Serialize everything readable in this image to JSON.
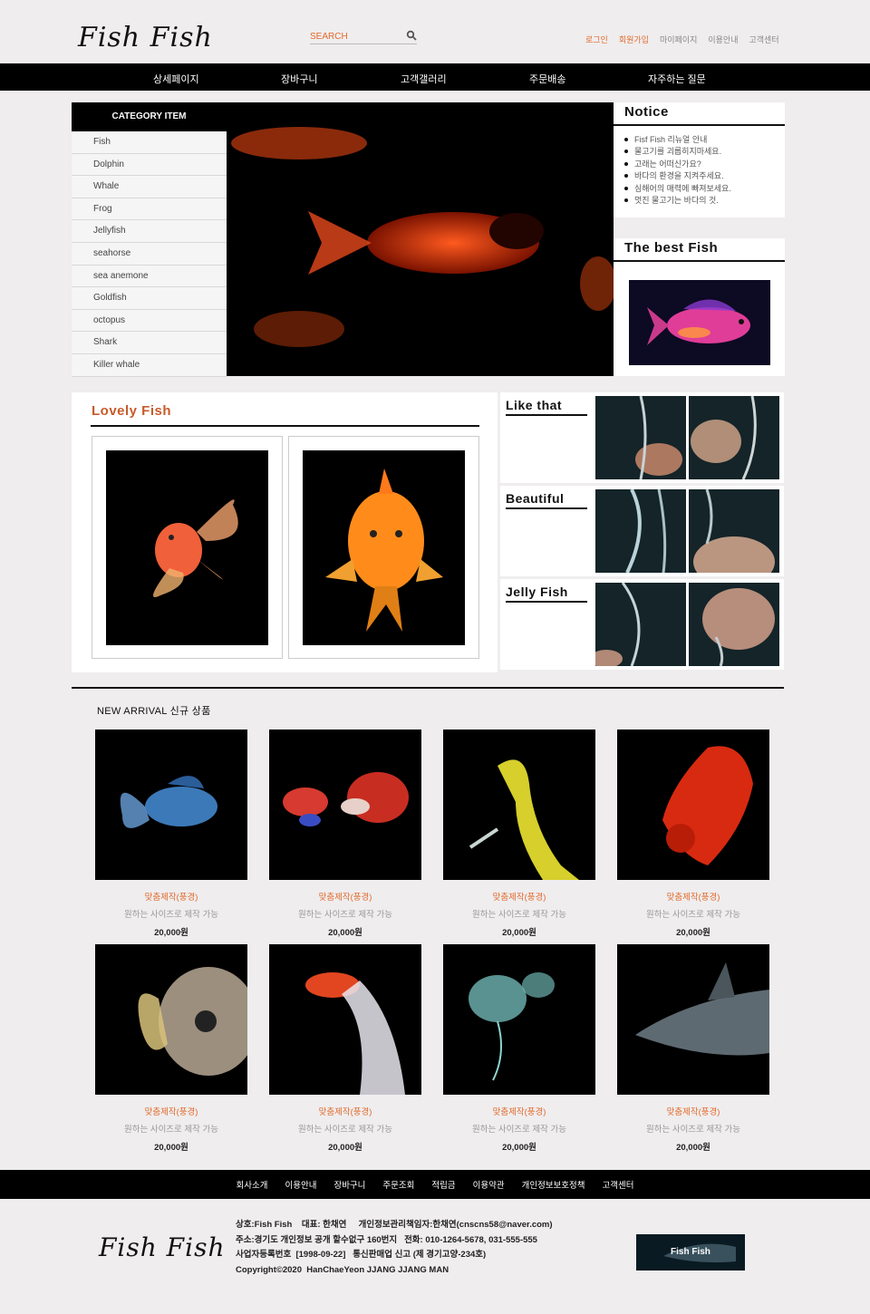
{
  "header": {
    "logo": "Fish Fish",
    "search_label": "SEARCH",
    "top_links": [
      "로그인",
      "회원가입",
      "마이페이지",
      "이용안내",
      "고객센터"
    ]
  },
  "nav": [
    "상세페이지",
    "장바구니",
    "고객갤러리",
    "주문배송",
    "자주하는 질문"
  ],
  "category": {
    "title": "CATEGORY ITEM",
    "items": [
      "Fish",
      "Dolphin",
      "Whale",
      "Frog",
      "Jellyfish",
      "seahorse",
      "sea anemone",
      "Goldfish",
      "octopus",
      "Shark",
      "Killer whale"
    ]
  },
  "notice": {
    "title": "Notice",
    "items": [
      "Fisf Fish 리뉴얼 안내",
      "물고기를 괴롭히지마세요.",
      "고래는 어떠신가요?",
      "바다의 환경을 지켜주세요.",
      "심해어의 매력에 빠져보세요.",
      "멋진 물고기는 바다의 것."
    ]
  },
  "best": {
    "title": "The best Fish"
  },
  "lovely": {
    "title": "Lovely Fish"
  },
  "side": [
    "Like that",
    "Beautiful",
    "Jelly Fish"
  ],
  "arrival": {
    "title": "NEW ARRIVAL  신규 상품",
    "products": [
      {
        "name": "맞춤제작(풍경)",
        "desc": "원하는 사이즈로 제작 가능",
        "price": "20,000원"
      },
      {
        "name": "맞춤제작(풍경)",
        "desc": "원하는 사이즈로 제작 가능",
        "price": "20,000원"
      },
      {
        "name": "맞춤제작(풍경)",
        "desc": "원하는 사이즈로 제작 가능",
        "price": "20,000원"
      },
      {
        "name": "맞춤제작(풍경)",
        "desc": "원하는 사이즈로 제작 가능",
        "price": "20,000원"
      },
      {
        "name": "맞춤제작(풍경)",
        "desc": "원하는 사이즈로 제작 가능",
        "price": "20,000원"
      },
      {
        "name": "맞춤제작(풍경)",
        "desc": "원하는 사이즈로 제작 가능",
        "price": "20,000원"
      },
      {
        "name": "맞춤제작(풍경)",
        "desc": "원하는 사이즈로 제작 가능",
        "price": "20,000원"
      },
      {
        "name": "맞춤제작(풍경)",
        "desc": "원하는 사이즈로 제작 가능",
        "price": "20,000원"
      }
    ]
  },
  "footer": {
    "nav": [
      "회사소개",
      "이용안내",
      "장바구니",
      "주문조회",
      "적립금",
      "이용약관",
      "개인정보보호정책",
      "고객센터"
    ],
    "logo": "Fish Fish",
    "info": [
      "상호:Fish Fish    대표: 한채연     개인정보관리책임자:한채연(cnscns58@naver.com)",
      "주소:경기도 개인정보 공개 할수없구 160번지   전화: 010-1264-5678, 031-555-555",
      "사업자등록번호  [1998-09-22]   통신판매업 신고 (제 경기고양-234호)",
      "Copyright©2020  HanChaeYeon JJANG JJANG MAN"
    ],
    "banner": "Fish Fish"
  },
  "colors": {
    "accent": "#e06a2c",
    "nav_bg": "#000000",
    "page_bg": "#efedee"
  }
}
